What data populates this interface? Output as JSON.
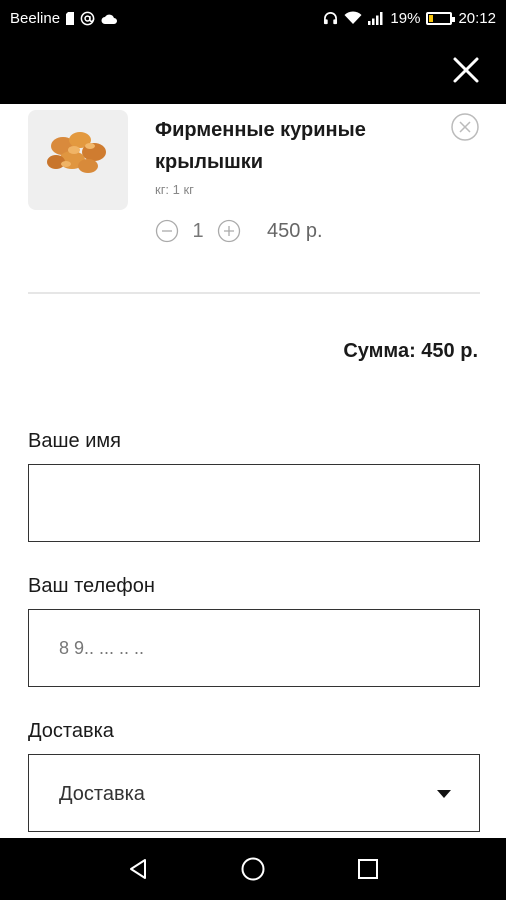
{
  "status_bar": {
    "carrier": "Beeline",
    "battery_percent": "19%",
    "battery_level": 0.19,
    "time": "20:12",
    "colors": {
      "background": "#000000",
      "battery_fill": "#f6c40c"
    },
    "icons": [
      "sim-icon",
      "at-icon",
      "cloud-icon",
      "headphones-icon",
      "wifi-icon",
      "signal-icon",
      "battery-icon"
    ]
  },
  "header": {
    "close_icon": "close-icon"
  },
  "cart": {
    "item": {
      "title": "Фирменные куриные крылышки",
      "weight": "кг: 1 кг",
      "quantity": "1",
      "price": "450 р."
    },
    "total": "Сумма: 450 р."
  },
  "form": {
    "name": {
      "label": "Ваше имя",
      "value": "",
      "placeholder": ""
    },
    "phone": {
      "label": "Ваш телефон",
      "value": "",
      "placeholder": "8 9.. ... .. .."
    },
    "delivery": {
      "label": "Доставка",
      "selected": "Доставка"
    }
  },
  "nav_bar": {
    "icons": [
      "back-icon",
      "home-icon",
      "recents-icon"
    ]
  }
}
